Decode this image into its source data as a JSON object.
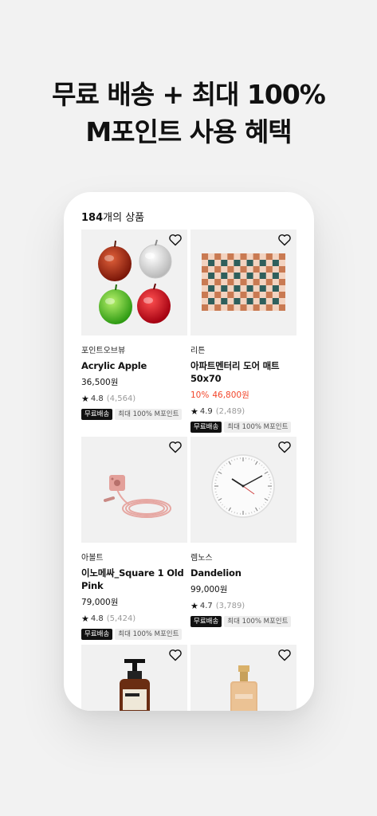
{
  "headline": {
    "line1": "무료 배송 + 최대 100%",
    "line2": "M포인트 사용 혜택"
  },
  "listing": {
    "count": "184",
    "count_suffix": "개의 상품"
  },
  "products": [
    {
      "brand": "포인트오브뷰",
      "name": "Acrylic Apple",
      "price": "36,500원",
      "rating": "4.8",
      "reviews": "(4,564)",
      "badge_free": "무료배송",
      "badge_point": "최대 100% M포인트",
      "image_icon": "acrylic-apple-image"
    },
    {
      "brand": "리튼",
      "name": "아파트멘터리 도어 매트 50x70",
      "discount": "10%",
      "sale_price": "46,800원",
      "rating": "4.9",
      "reviews": "(2,489)",
      "badge_free": "무료배송",
      "badge_point": "최대 100% M포인트",
      "image_icon": "checkered-mat-image"
    },
    {
      "brand": "아볼트",
      "name": "이노메싸_Square 1 Old Pink",
      "price": "79,000원",
      "rating": "4.8",
      "reviews": "(5,424)",
      "badge_free": "무료배송",
      "badge_point": "최대 100% M포인트",
      "image_icon": "power-cube-image"
    },
    {
      "brand": "렘노스",
      "name": "Dandelion",
      "price": "99,000원",
      "rating": "4.7",
      "reviews": "(3,789)",
      "badge_free": "무료배송",
      "badge_point": "최대 100% M포인트",
      "image_icon": "wall-clock-image"
    },
    {
      "image_icon": "amber-pump-bottle-image"
    },
    {
      "image_icon": "foundation-bottle-image"
    }
  ],
  "icons": {
    "wishlist": "heart-icon",
    "rating": "star-icon"
  },
  "colors": {
    "sale": "#f2452a",
    "badge": "#111111",
    "background": "#f2f2f2"
  }
}
